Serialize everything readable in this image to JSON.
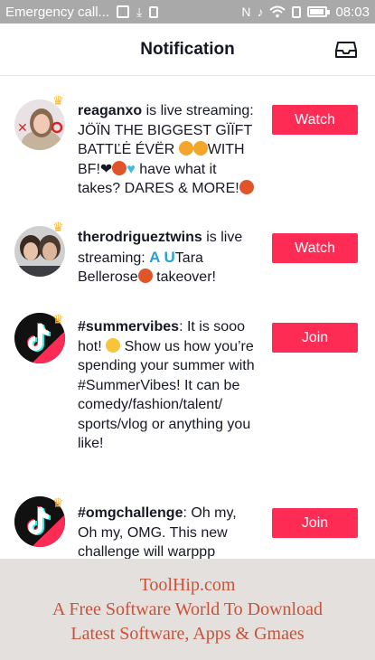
{
  "status_bar": {
    "notification_text": "Emergency call...",
    "time": "08:03",
    "battery_level": 0.9,
    "icons": [
      "image-icon",
      "download-icon",
      "sim-icon",
      "nfc-icon",
      "mute-icon",
      "wifi-icon",
      "sim-card-icon",
      "battery-icon"
    ]
  },
  "header": {
    "title": "Notification",
    "inbox_icon": "inbox-icon"
  },
  "notifications": [
    {
      "username": "reaganxo",
      "text_lines": [
        " is live streaming:",
        "JÖÏN THE BIGGEST GÏÏFT",
        "BATTĽĖ ÉVËR ",
        "WITH",
        "BF!❤",
        " have what it",
        "takes? DARES & MORE!"
      ],
      "button": "Watch"
    },
    {
      "username": "therodrigueztwins",
      "text_lines": [
        " is live",
        "streaming: ",
        "A U",
        "Tara",
        "Bellerose",
        " takeover!"
      ],
      "button": "Watch"
    },
    {
      "username": "#summervibes",
      "text": ": It is sooo hot! ",
      "text_after_emoji": " Show us how you’re spending your summer with #SummerVibes! It can be comedy/fashion/talent/ sports/vlog or anything you like!",
      "button": "Join"
    },
    {
      "username": "#omgchallenge",
      "text": ": Oh my, Oh my, OMG. This new challenge will warppp",
      "button": "Join"
    }
  ],
  "footer": {
    "line1": "ToolHip.com",
    "line2": "A Free Software World To Download",
    "line3": "Latest Software, Apps & Gmaes"
  },
  "colors": {
    "accent": "#fe2c55",
    "status_bar": "#a9a9a9",
    "footer_bg": "#e4e0de",
    "footer_text": "#c7533a"
  }
}
